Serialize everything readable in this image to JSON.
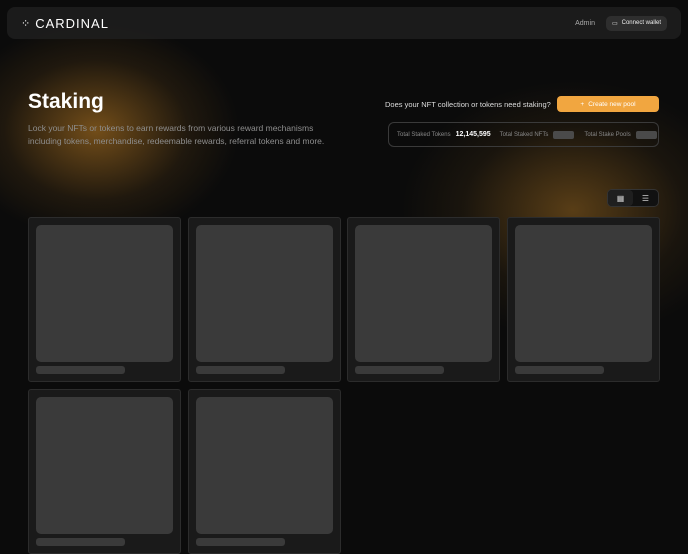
{
  "nav": {
    "brand": "CARDINAL",
    "admin": "Admin",
    "connect_wallet": "Connect wallet"
  },
  "hero": {
    "title": "Staking",
    "description": "Lock your NFTs or tokens to earn rewards from various reward mechanisms including tokens, merchandise, redeemable rewards, referral tokens and more.",
    "question": "Does your NFT collection or tokens need staking?",
    "create_button": "Create new pool"
  },
  "stats": {
    "tokens_label": "Total Staked Tokens",
    "tokens_value": "12,145,595",
    "nfts_label": "Total Staked NFTs",
    "pools_label": "Total Stake Pools"
  },
  "colors": {
    "accent": "#f1a640"
  }
}
